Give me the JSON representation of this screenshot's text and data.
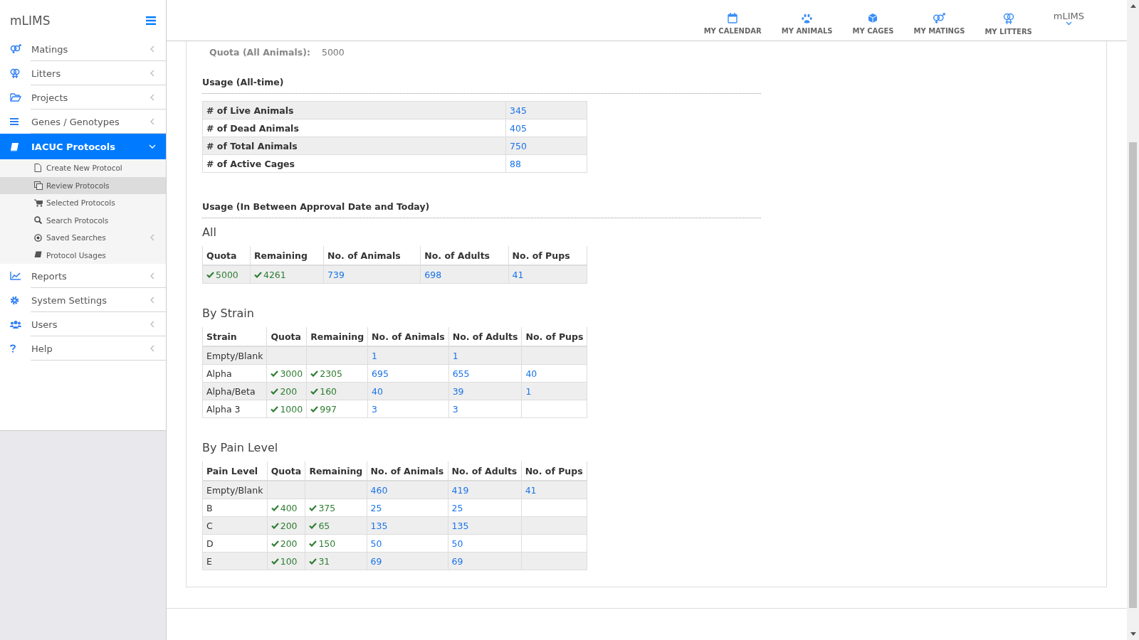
{
  "sidebar": {
    "brand": "mLIMS",
    "items": [
      {
        "label": "Matings",
        "selected": false,
        "expanded": false
      },
      {
        "label": "Litters",
        "selected": false,
        "expanded": false
      },
      {
        "label": "Projects",
        "selected": false,
        "expanded": false
      },
      {
        "label": "Genes / Genotypes",
        "selected": false,
        "expanded": false
      },
      {
        "label": "IACUC Protocols",
        "selected": true,
        "expanded": true,
        "children": [
          {
            "label": "Create New Protocol",
            "selected": false,
            "kind": "link"
          },
          {
            "label": "Review Protocols",
            "selected": true,
            "kind": "link"
          },
          {
            "label": "Selected Protocols",
            "selected": false,
            "kind": "link"
          },
          {
            "label": "Search Protocols",
            "selected": false,
            "kind": "link"
          },
          {
            "label": "Saved Searches",
            "selected": false,
            "kind": "group"
          },
          {
            "label": "Protocol Usages",
            "selected": false,
            "kind": "link"
          }
        ]
      },
      {
        "label": "Reports",
        "selected": false,
        "expanded": false
      },
      {
        "label": "System Settings",
        "selected": false,
        "expanded": false
      },
      {
        "label": "Users",
        "selected": false,
        "expanded": false
      },
      {
        "label": "Help",
        "selected": false,
        "expanded": false
      }
    ]
  },
  "topnav": {
    "items": [
      "MY CALENDAR",
      "MY ANIMALS",
      "MY CAGES",
      "MY MATINGS",
      "MY LITTERS"
    ],
    "user": "mLIMS"
  },
  "content": {
    "quota_label": "Quota (All Animals):",
    "quota_value": "5000",
    "alltime": {
      "title": "Usage (All-time)",
      "rows": [
        {
          "label": "# of Live Animals",
          "value": "345"
        },
        {
          "label": "# of Dead Animals",
          "value": "405"
        },
        {
          "label": "# of Total Animals",
          "value": "750"
        },
        {
          "label": "# of Active Cages",
          "value": "88"
        }
      ]
    },
    "between": {
      "title": "Usage (In Between Approval Date and Today)",
      "tables": [
        {
          "title": "All",
          "columns": [
            {
              "label": "Quota",
              "kind": "check"
            },
            {
              "label": "Remaining",
              "kind": "check"
            },
            {
              "label": "No. of Animals",
              "kind": "link"
            },
            {
              "label": "No. of Adults",
              "kind": "link"
            },
            {
              "label": "No. of Pups",
              "kind": "link"
            }
          ],
          "rows": [
            [
              "5000",
              "4261",
              "739",
              "698",
              "41"
            ]
          ]
        },
        {
          "title": "By Strain",
          "columns": [
            {
              "label": "Strain",
              "kind": "text"
            },
            {
              "label": "Quota",
              "kind": "check"
            },
            {
              "label": "Remaining",
              "kind": "check"
            },
            {
              "label": "No. of Animals",
              "kind": "link"
            },
            {
              "label": "No. of Adults",
              "kind": "link"
            },
            {
              "label": "No. of Pups",
              "kind": "link"
            }
          ],
          "rows": [
            [
              "Empty/Blank",
              null,
              null,
              "1",
              "1",
              null
            ],
            [
              "Alpha",
              "3000",
              "2305",
              "695",
              "655",
              "40"
            ],
            [
              "Alpha/Beta",
              "200",
              "160",
              "40",
              "39",
              "1"
            ],
            [
              "Alpha 3",
              "1000",
              "997",
              "3",
              "3",
              null
            ]
          ]
        },
        {
          "title": "By Pain Level",
          "columns": [
            {
              "label": "Pain Level",
              "kind": "text"
            },
            {
              "label": "Quota",
              "kind": "check"
            },
            {
              "label": "Remaining",
              "kind": "check"
            },
            {
              "label": "No. of Animals",
              "kind": "link"
            },
            {
              "label": "No. of Adults",
              "kind": "link"
            },
            {
              "label": "No. of Pups",
              "kind": "link"
            }
          ],
          "rows": [
            [
              "Empty/Blank",
              null,
              null,
              "460",
              "419",
              "41"
            ],
            [
              "B",
              "400",
              "375",
              "25",
              "25",
              null
            ],
            [
              "C",
              "200",
              "65",
              "135",
              "135",
              null
            ],
            [
              "D",
              "200",
              "150",
              "50",
              "50",
              null
            ],
            [
              "E",
              "100",
              "31",
              "69",
              "69",
              null
            ]
          ]
        }
      ]
    }
  }
}
